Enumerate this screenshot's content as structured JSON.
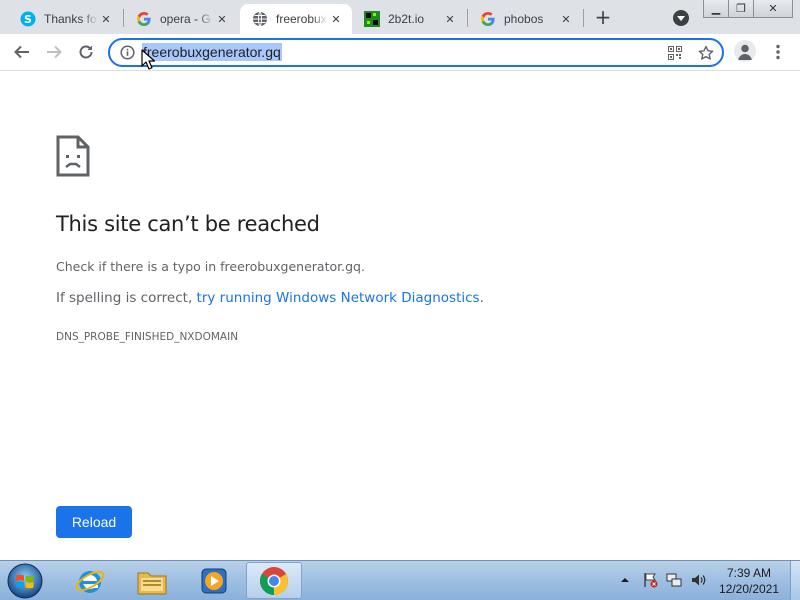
{
  "browser": {
    "tabs": [
      {
        "title": "Thanks fo",
        "icon": "skype-icon",
        "active": false
      },
      {
        "title": "opera - G",
        "icon": "google-icon",
        "active": false
      },
      {
        "title": "freerobux",
        "icon": "globe-icon",
        "active": true
      },
      {
        "title": "2b2t.io",
        "icon": "2b2t-icon",
        "active": false
      },
      {
        "title": "phobos",
        "icon": "google-icon",
        "active": false
      }
    ],
    "close_glyph": "✕",
    "new_tab_glyph": "+",
    "window_controls": {
      "minimize": "▁",
      "restore": "❐",
      "close": "✕"
    },
    "address": {
      "url": "freerobuxgenerator.gq",
      "selected": true
    }
  },
  "error_page": {
    "title": "This site can’t be reached",
    "line1": "Check if there is a typo in freerobuxgenerator.gq.",
    "line2_prefix": "If spelling is correct, ",
    "line2_link": "try running Windows Network Diagnostics",
    "line2_suffix": ".",
    "error_code": "DNS_PROBE_FINISHED_NXDOMAIN",
    "reload_label": "Reload"
  },
  "taskbar": {
    "apps": [
      "internet-explorer-icon",
      "file-explorer-icon",
      "media-player-icon",
      "chrome-icon"
    ],
    "active_app": "chrome-icon",
    "clock_time": "7:39 AM",
    "clock_date": "12/20/2021"
  },
  "colors": {
    "accent": "#1a73e8",
    "tabstrip_bg": "#dee1e6",
    "url_selection": "#a8c7fa",
    "text_primary": "#202124",
    "text_secondary": "#5f6368"
  }
}
